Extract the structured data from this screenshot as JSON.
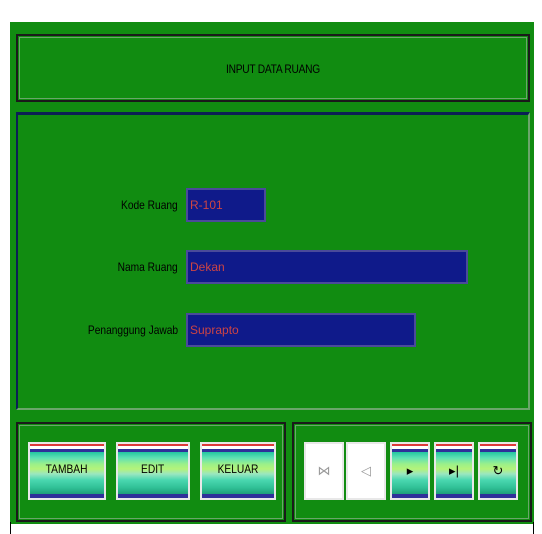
{
  "form": {
    "title": "INPUT DATA RUANG",
    "fields": [
      {
        "label": "Kode Ruang",
        "value": "R-101"
      },
      {
        "label": "Nama Ruang",
        "value": "Dekan"
      },
      {
        "label": "Penanggung Jawab",
        "value": "Suprapto"
      }
    ]
  },
  "buttons": {
    "add": "TAMBAH",
    "edit": "EDIT",
    "exit": "KELUAR"
  },
  "navigation": {
    "first_icon": "first-record-icon",
    "prev_icon": "previous-record-icon",
    "next_icon": "next-record-icon",
    "last_icon": "last-record-icon",
    "refresh_icon": "refresh-icon",
    "first_glyph": "⋈",
    "prev_glyph": "◁",
    "next_glyph": "▸",
    "last_glyph": "▸|",
    "refresh_glyph": "↻"
  },
  "colors": {
    "form_background": "#118c11",
    "input_background": "#0f1a8a",
    "input_text": "#cc4444"
  }
}
